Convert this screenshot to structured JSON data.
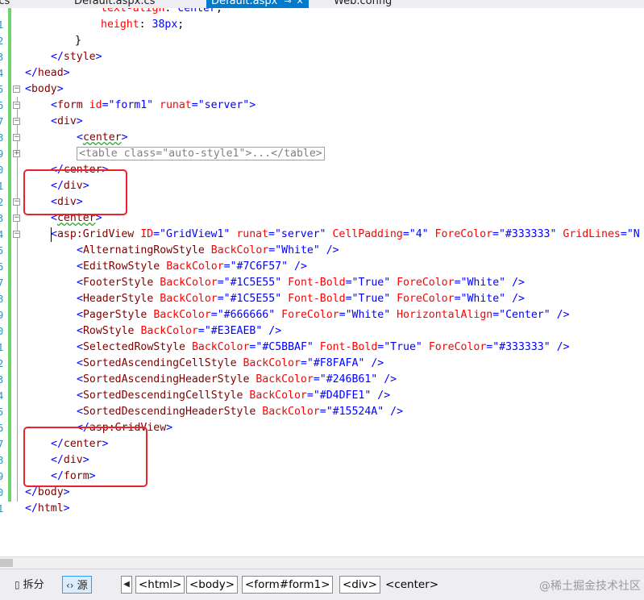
{
  "tabs": [
    {
      "label": "n.cs",
      "active": false
    },
    {
      "label": "Default.aspx.cs",
      "active": false
    },
    {
      "label": "Default.aspx",
      "active": true,
      "pin": "⊸",
      "close": "✕"
    },
    {
      "label": "Web.config",
      "active": false
    }
  ],
  "line_numbers": [
    "1",
    "2",
    "3",
    "4",
    "5",
    "6",
    "7",
    "8",
    "9",
    "0",
    "1",
    "2",
    "3",
    "4",
    "5",
    "6",
    "7",
    "8",
    "9",
    "0",
    "1",
    "2",
    "3",
    "4",
    "5",
    "6",
    "7",
    "8",
    "9",
    "0",
    "1"
  ],
  "code": {
    "l0": {
      "prop": "text-align",
      "colon": ": ",
      "val": "center",
      "semi": ";"
    },
    "l1": {
      "prop": "height",
      "colon": ": ",
      "val": "38px",
      "semi": ";"
    },
    "l2": {
      "text": "}"
    },
    "l3": {
      "open": "</",
      "tag": "style",
      "close": ">"
    },
    "l4": {
      "open": "</",
      "tag": "head",
      "close": ">"
    },
    "l5": {
      "open": "<",
      "tag": "body",
      "close": ">"
    },
    "l6": {
      "open": "<",
      "tag": "form",
      "a1": "id",
      "v1": "\"form1\"",
      "a2": "runat",
      "v2": "\"server\"",
      "close": ">"
    },
    "l7": {
      "open": "<",
      "tag": "div",
      "close": ">"
    },
    "l8": {
      "open": "<",
      "tag": "center",
      "close": ">"
    },
    "l9": {
      "collapsed": "<table class=\"auto-style1\">...</table>"
    },
    "l10": {
      "open": "</",
      "tag": "center",
      "close": ">"
    },
    "l11": {
      "open": "</",
      "tag": "div",
      "close": ">"
    },
    "l12": {
      "open": "<",
      "tag": "div",
      "close": ">"
    },
    "l13": {
      "open": "<",
      "tag": "center",
      "close": ">"
    },
    "l14": {
      "open": "<",
      "tag": "asp:GridView",
      "a1": "ID",
      "v1": "\"GridView1\"",
      "a2": "runat",
      "v2": "\"server\"",
      "a3": "CellPadding",
      "v3": "\"4\"",
      "a4": "ForeColor",
      "v4": "\"#333333\"",
      "a5": "GridLines",
      "v5": "\"N"
    },
    "l15": {
      "open": "<",
      "tag": "AlternatingRowStyle",
      "a1": "BackColor",
      "v1": "\"White\"",
      "close": "/>"
    },
    "l16": {
      "open": "<",
      "tag": "EditRowStyle",
      "a1": "BackColor",
      "v1": "\"#7C6F57\"",
      "close": "/>"
    },
    "l17": {
      "open": "<",
      "tag": "FooterStyle",
      "a1": "BackColor",
      "v1": "\"#1C5E55\"",
      "a2": "Font-Bold",
      "v2": "\"True\"",
      "a3": "ForeColor",
      "v3": "\"White\"",
      "close": "/>"
    },
    "l18": {
      "open": "<",
      "tag": "HeaderStyle",
      "a1": "BackColor",
      "v1": "\"#1C5E55\"",
      "a2": "Font-Bold",
      "v2": "\"True\"",
      "a3": "ForeColor",
      "v3": "\"White\"",
      "close": "/>"
    },
    "l19": {
      "open": "<",
      "tag": "PagerStyle",
      "a1": "BackColor",
      "v1": "\"#666666\"",
      "a2": "ForeColor",
      "v2": "\"White\"",
      "a3": "HorizontalAlign",
      "v3": "\"Center\"",
      "close": "/>"
    },
    "l20": {
      "open": "<",
      "tag": "RowStyle",
      "a1": "BackColor",
      "v1": "\"#E3EAEB\"",
      "close": "/>"
    },
    "l21": {
      "open": "<",
      "tag": "SelectedRowStyle",
      "a1": "BackColor",
      "v1": "\"#C5BBAF\"",
      "a2": "Font-Bold",
      "v2": "\"True\"",
      "a3": "ForeColor",
      "v3": "\"#333333\"",
      "close": "/>"
    },
    "l22": {
      "open": "<",
      "tag": "SortedAscendingCellStyle",
      "a1": "BackColor",
      "v1": "\"#F8FAFA\"",
      "close": "/>"
    },
    "l23": {
      "open": "<",
      "tag": "SortedAscendingHeaderStyle",
      "a1": "BackColor",
      "v1": "\"#246B61\"",
      "close": "/>"
    },
    "l24": {
      "open": "<",
      "tag": "SortedDescendingCellStyle",
      "a1": "BackColor",
      "v1": "\"#D4DFE1\"",
      "close": "/>"
    },
    "l25": {
      "open": "<",
      "tag": "SortedDescendingHeaderStyle",
      "a1": "BackColor",
      "v1": "\"#15524A\"",
      "close": "/>"
    },
    "l26": {
      "open": "</",
      "tag": "asp:GridView",
      "close": ">"
    },
    "l27": {
      "open": "</",
      "tag": "center",
      "close": ">"
    },
    "l28": {
      "open": "</",
      "tag": "div",
      "close": ">"
    },
    "l29": {
      "open": "</",
      "tag": "form",
      "close": ">"
    },
    "l30": {
      "open": "</",
      "tag": "body",
      "close": ">"
    },
    "l31": {
      "open": "</",
      "tag": "html",
      "close": ">"
    }
  },
  "bottom": {
    "split_label": "拆分",
    "source_label": "源",
    "split_icon": "split-view-icon",
    "source_icon": "source-view-icon",
    "breadcrumbs": [
      "<html>",
      "<body>",
      "<form#form1>",
      "<div>",
      "<center>"
    ],
    "watermark": "@稀土掘金技术社区"
  },
  "colors": {
    "tag": "#800000",
    "attribute": "#ff0000",
    "value": "#0000ff",
    "annotation": "#e8232a",
    "change_bar": "#6ed36e",
    "active_tab": "#007acc"
  }
}
